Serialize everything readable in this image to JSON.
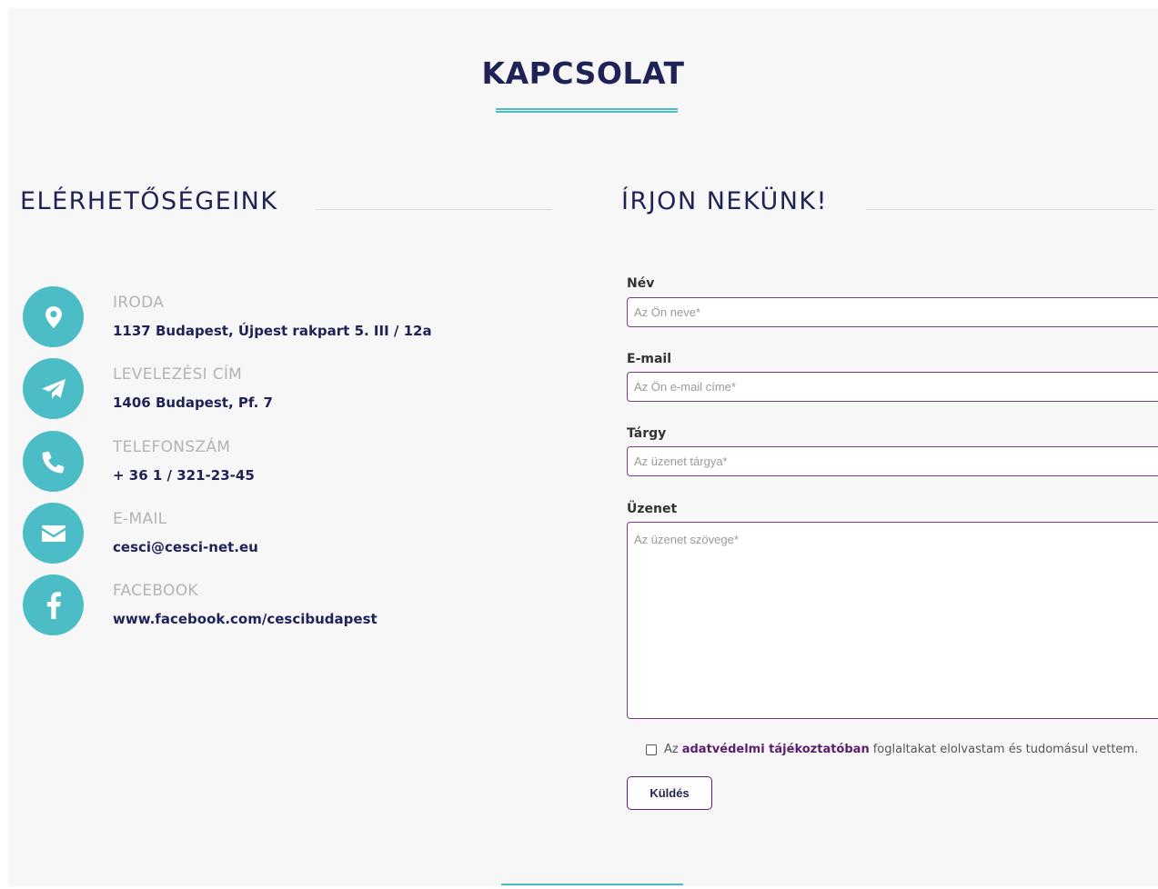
{
  "page": {
    "title": "KAPCSOLAT"
  },
  "contacts": {
    "heading": "ELÉRHETŐSÉGEINK",
    "items": [
      {
        "icon": "map-pin-icon",
        "label": "IRODA",
        "value": "1137 Budapest, Újpest rakpart 5. III / 12a"
      },
      {
        "icon": "paper-plane-icon",
        "label": "LEVELEZÉSI CÍM",
        "value": "1406 Budapest, Pf. 7"
      },
      {
        "icon": "phone-icon",
        "label": "TELEFONSZÁM",
        "value": "+ 36 1 / 321-23-45"
      },
      {
        "icon": "envelope-icon",
        "label": "E-MAIL",
        "value": "cesci@cesci-net.eu"
      },
      {
        "icon": "facebook-icon",
        "label": "FACEBOOK",
        "value": "www.facebook.com/cescibudapest"
      }
    ]
  },
  "form": {
    "heading": "ÍRJON NEKÜNK!",
    "name_label": "Név",
    "name_placeholder": "Az Ön neve*",
    "email_label": "E-mail",
    "email_placeholder": "Az Ön e-mail címe*",
    "subject_label": "Tárgy",
    "subject_placeholder": "Az üzenet tárgya*",
    "message_label": "Üzenet",
    "message_placeholder": "Az üzenet szövege*",
    "consent_prefix": "Az",
    "consent_link": "adatvédelmi tájékoztatóban",
    "consent_suffix": "foglaltakat elolvastam és tudomásul vettem.",
    "submit_label": "Küldés"
  },
  "colors": {
    "navy": "#1f2255",
    "teal": "#4cbcc7",
    "purple": "#7a3b84",
    "label_gray": "#b4b4b4",
    "background": "#f7f7f7"
  }
}
